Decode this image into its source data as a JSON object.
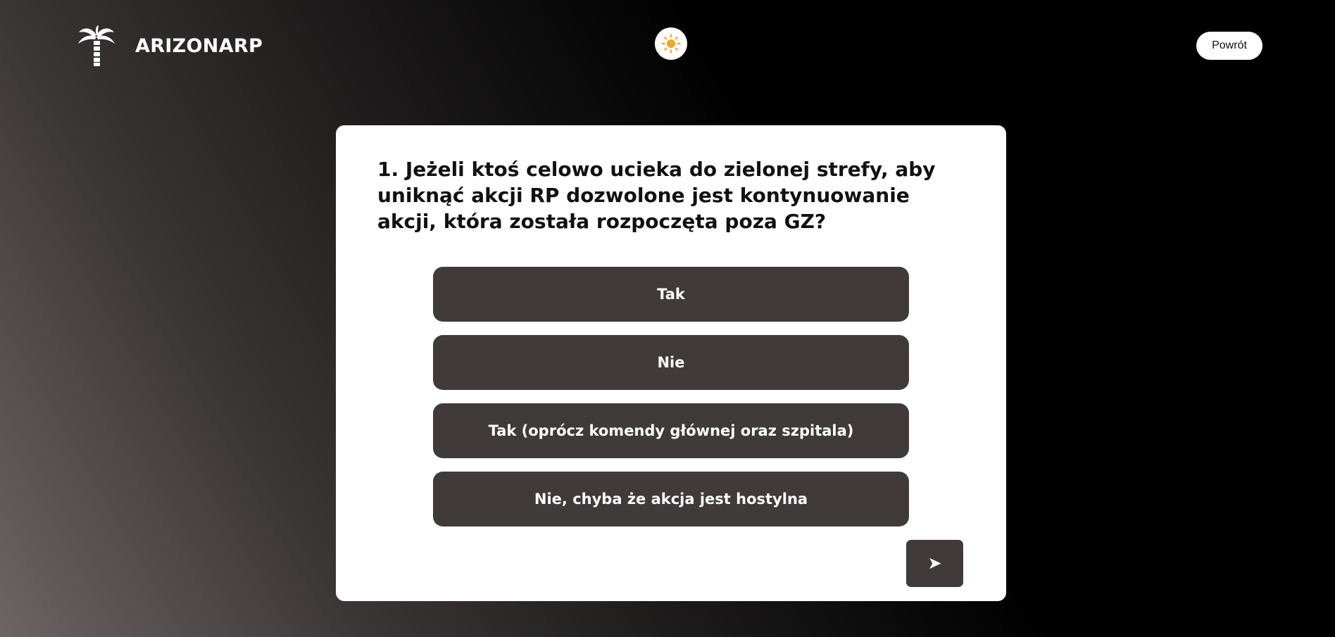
{
  "header": {
    "brand_name": "ARIZONARP",
    "logo_icon": "palm-tree-icon",
    "theme_icon": "sun-icon",
    "back_label": "Powrót"
  },
  "quiz": {
    "question": "1. Jeżeli ktoś celowo ucieka do zielonej strefy, aby uniknąć akcji RP dozwolone jest kontynuowanie akcji, która została rozpoczęta poza GZ?",
    "answers": [
      "Tak",
      "Nie",
      "Tak (oprócz komendy głównej oraz szpitala)",
      "Nie, chyba że akcja jest hostylna"
    ],
    "submit_icon": "send-arrow-icon",
    "submit_glyph": "➤"
  },
  "colors": {
    "card_bg": "#ffffff",
    "answer_bg": "#403a3a",
    "sun": "#f5a623"
  }
}
